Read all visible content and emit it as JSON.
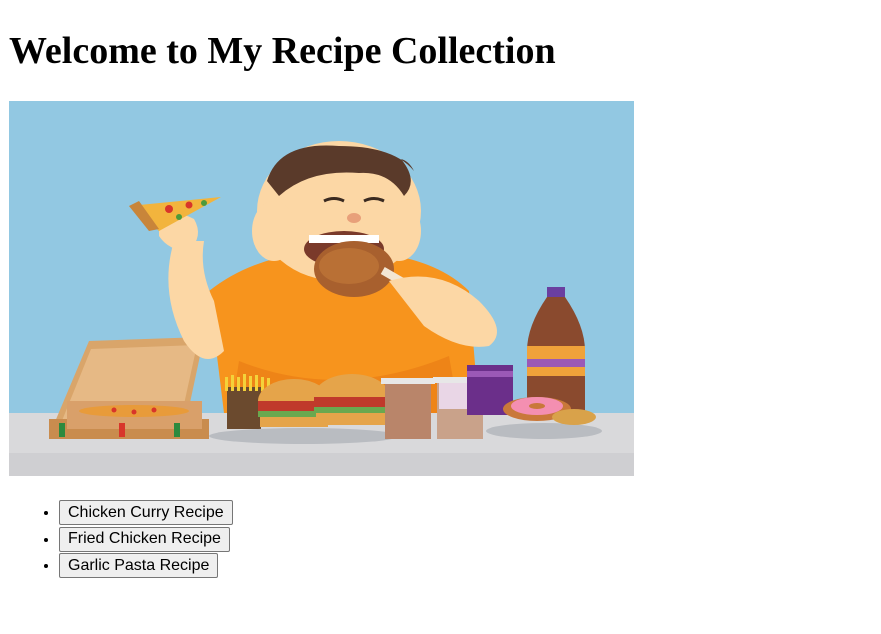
{
  "page": {
    "heading": "Welcome to My Recipe Collection"
  },
  "hero_image": {
    "description_icon": "man-eating-fast-food-illustration",
    "colors": {
      "sky": "#92c8e2",
      "table": "#d9d9db",
      "shirt": "#f7941d",
      "skin": "#fcd7a5",
      "hair": "#5a3a2a"
    }
  },
  "recipes": {
    "items": [
      {
        "label": "Chicken Curry Recipe"
      },
      {
        "label": "Fried Chicken Recipe"
      },
      {
        "label": "Garlic Pasta Recipe"
      }
    ]
  }
}
